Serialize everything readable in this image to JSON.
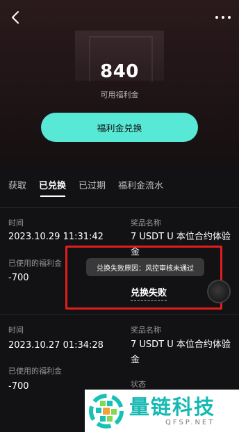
{
  "header": {
    "back_icon": "chevron-left-icon",
    "more_icon": "more-dots-icon"
  },
  "balance": {
    "value": "840",
    "label": "可用福利金"
  },
  "exchange_button": {
    "label": "福利金兑换",
    "color": "#58e8d6"
  },
  "tabs": [
    {
      "label": "获取",
      "active": false
    },
    {
      "label": "已兑换",
      "active": true
    },
    {
      "label": "已过期",
      "active": false
    },
    {
      "label": "福利金流水",
      "active": false
    }
  ],
  "records": [
    {
      "time_label": "时间",
      "time": "2023.10.29 11:31:42",
      "used_label": "已使用的福利金",
      "used": "-700",
      "prize_label": "奖品名称",
      "prize_line1": "7 USDT U 本位合约体验",
      "prize_line2": "金",
      "status": "兑换失败"
    },
    {
      "time_label": "时间",
      "time": "2023.10.27 01:34:28",
      "used_label": "已使用的福利金",
      "used": "-700",
      "prize_label": "奖品名称",
      "prize_line1": "7 USDT U 本位合约体验",
      "prize_line2": "金",
      "status_label": "状态"
    }
  ],
  "tooltip": {
    "text": "兑换失败原因：风控审核未通过"
  },
  "annotation": {
    "color": "#e21d1d"
  },
  "watermark": {
    "cn": "量链科技",
    "en": "QFSP.NET"
  }
}
